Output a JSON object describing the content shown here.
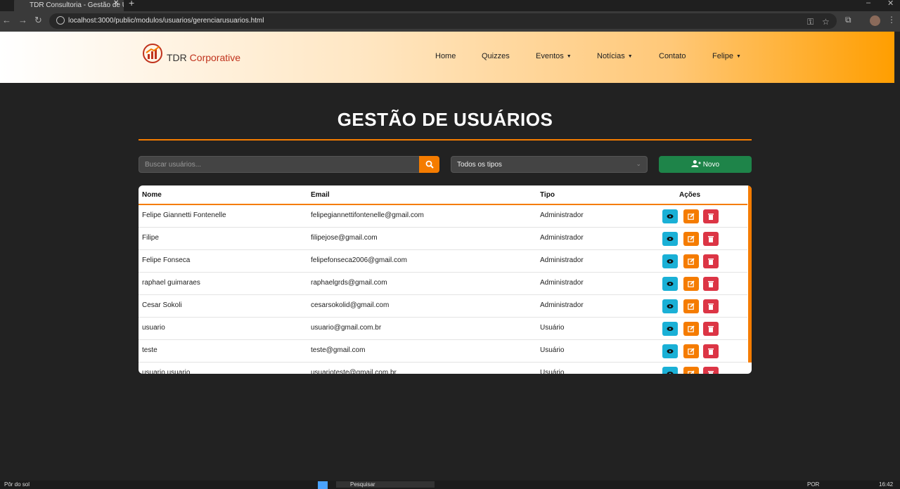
{
  "browser": {
    "tab_title": "TDR Consultoria - Gestão de U...",
    "url": "localhost:3000/public/modulos/usuarios/gerenciarusuarios.html"
  },
  "navbar": {
    "brand_prefix": "TDR",
    "brand_accent": "Corporative",
    "links": [
      {
        "label": "Home",
        "dropdown": false
      },
      {
        "label": "Quizzes",
        "dropdown": false
      },
      {
        "label": "Eventos",
        "dropdown": true
      },
      {
        "label": "Notícias",
        "dropdown": true
      },
      {
        "label": "Contato",
        "dropdown": false
      },
      {
        "label": "Felipe",
        "dropdown": true
      }
    ]
  },
  "main": {
    "title": "GESTÃO DE USUÁRIOS",
    "search_placeholder": "Buscar usuários...",
    "type_filter": "Todos os tipos",
    "new_button": "Novo"
  },
  "table": {
    "headers": [
      "Nome",
      "Email",
      "Tipo",
      "Ações"
    ],
    "rows": [
      {
        "name": "Felipe Giannetti Fontenelle",
        "email": "felipegiannettifontenelle@gmail.com",
        "type": "Administrador"
      },
      {
        "name": "Filipe",
        "email": "filipejose@gmail.com",
        "type": "Administrador"
      },
      {
        "name": "Felipe Fonseca",
        "email": "felipefonseca2006@gmail.com",
        "type": "Administrador"
      },
      {
        "name": "raphael guimaraes",
        "email": "raphaelgrds@gmail.com",
        "type": "Administrador"
      },
      {
        "name": "Cesar Sokoli",
        "email": "cesarsokolid@gmail.com",
        "type": "Administrador"
      },
      {
        "name": "usuario",
        "email": "usuario@gmail.com.br",
        "type": "Usuário"
      },
      {
        "name": "teste",
        "email": "teste@gmail.com",
        "type": "Usuário"
      },
      {
        "name": "usuario usuario",
        "email": "usuarioteste@gmail.com.br",
        "type": "Usuário"
      }
    ]
  },
  "taskbar": {
    "weather": "Pôr do sol",
    "search": "Pesquisar",
    "lang": "POR",
    "time": "16:42"
  },
  "colors": {
    "accent": "#f57c00",
    "success": "#1e8449",
    "info": "#1ab0d6",
    "danger": "#dc3545",
    "background": "#222222"
  },
  "icons": [
    "search-icon",
    "user-plus-icon",
    "eye-icon",
    "edit-icon",
    "trash-icon",
    "chevron-down-icon"
  ]
}
